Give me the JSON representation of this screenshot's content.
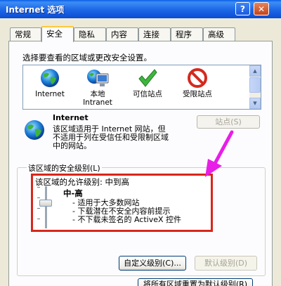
{
  "window": {
    "title": "Internet 选项"
  },
  "titlebar": {
    "help_glyph": "?",
    "close_glyph": "✕"
  },
  "tabs": [
    {
      "label": "常规",
      "active": false
    },
    {
      "label": "安全",
      "active": true
    },
    {
      "label": "隐私",
      "active": false
    },
    {
      "label": "内容",
      "active": false
    },
    {
      "label": "连接",
      "active": false
    },
    {
      "label": "程序",
      "active": false
    },
    {
      "label": "高级",
      "active": false
    }
  ],
  "security": {
    "instruction": "选择要查看的区域或更改安全设置。",
    "zones": [
      {
        "label": "Internet",
        "label2": "",
        "icon": "globe-icon"
      },
      {
        "label": "本地",
        "label2": "Intranet",
        "icon": "local-intranet-icon"
      },
      {
        "label": "可信站点",
        "label2": "",
        "icon": "checkmark-icon"
      },
      {
        "label": "受限站点",
        "label2": "",
        "icon": "no-entry-icon"
      }
    ],
    "selected_zone": {
      "name": "Internet",
      "desc_line1": "该区域适用于 Internet 网站，但",
      "desc_line2": "不适用于列在受信任和受限制区域",
      "desc_line3": "中的网站。",
      "sites_button": "站点(S)"
    },
    "level": {
      "group_label": "该区域的安全级别(L)",
      "allowed_text": "该区域的允许级别: 中到高",
      "name": "中-高",
      "bullets": [
        "- 适用于大多数网站",
        "- 下载潜在不安全内容前提示",
        "- 不下载未签名的 ActiveX 控件"
      ],
      "custom_button": "自定义级别(C)...",
      "default_button": "默认级别(D)",
      "reset_button": "将所有区域重置为默认级别(R)"
    }
  },
  "colors": {
    "highlight_box": "#D8261B",
    "annotation_arrow": "#E81EE8"
  }
}
